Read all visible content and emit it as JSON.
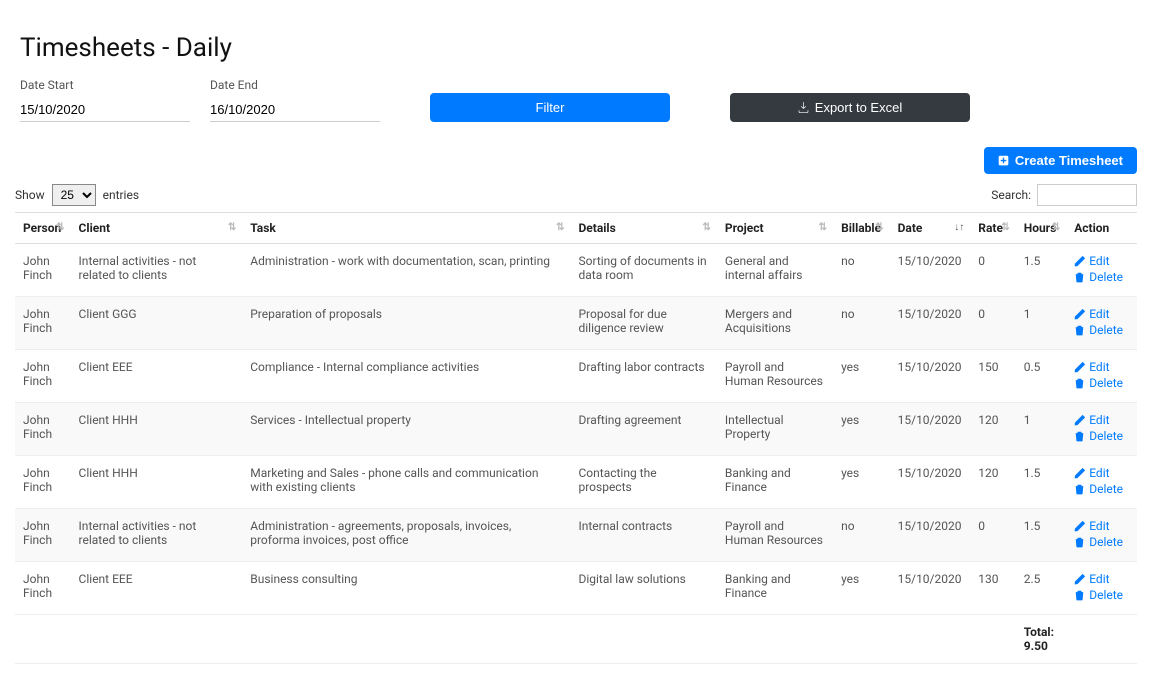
{
  "page_title": "Timesheets - Daily",
  "filters": {
    "date_start_label": "Date Start",
    "date_start_value": "15/10/2020",
    "date_end_label": "Date End",
    "date_end_value": "16/10/2020",
    "filter_button": "Filter",
    "export_button": "Export to Excel"
  },
  "create_button": "Create Timesheet",
  "entries": {
    "show_label": "Show",
    "entries_label": "entries",
    "selected": "25"
  },
  "search_label": "Search:",
  "columns": {
    "person": "Person",
    "client": "Client",
    "task": "Task",
    "details": "Details",
    "project": "Project",
    "billable": "Billable",
    "date": "Date",
    "rate": "Rate",
    "hours": "Hours",
    "action": "Action"
  },
  "rows": [
    {
      "person": "John Finch",
      "client": "Internal activities - not related to clients",
      "task": "Administration - work with documentation, scan, printing",
      "details": "Sorting of documents in data room",
      "project": "General and internal affairs",
      "billable": "no",
      "date": "15/10/2020",
      "rate": "0",
      "hours": "1.5"
    },
    {
      "person": "John Finch",
      "client": "Client GGG",
      "task": "Preparation of proposals",
      "details": "Proposal for due diligence review",
      "project": "Mergers and Acquisitions",
      "billable": "no",
      "date": "15/10/2020",
      "rate": "0",
      "hours": "1"
    },
    {
      "person": "John Finch",
      "client": "Client EEE",
      "task": "Compliance - Internal compliance activities",
      "details": "Drafting labor contracts",
      "project": "Payroll and Human Resources",
      "billable": "yes",
      "date": "15/10/2020",
      "rate": "150",
      "hours": "0.5"
    },
    {
      "person": "John Finch",
      "client": "Client HHH",
      "task": "Services - Intellectual property",
      "details": "Drafting agreement",
      "project": "Intellectual Property",
      "billable": "yes",
      "date": "15/10/2020",
      "rate": "120",
      "hours": "1"
    },
    {
      "person": "John Finch",
      "client": "Client HHH",
      "task": "Marketing and Sales - phone calls and communication with existing clients",
      "details": "Contacting the prospects",
      "project": "Banking and Finance",
      "billable": "yes",
      "date": "15/10/2020",
      "rate": "120",
      "hours": "1.5"
    },
    {
      "person": "John Finch",
      "client": "Internal activities - not related to clients",
      "task": "Administration - agreements, proposals, invoices, proforma invoices, post office",
      "details": "Internal contracts",
      "project": "Payroll and Human Resources",
      "billable": "no",
      "date": "15/10/2020",
      "rate": "0",
      "hours": "1.5"
    },
    {
      "person": "John Finch",
      "client": "Client EEE",
      "task": "Business consulting",
      "details": "Digital law solutions",
      "project": "Banking and Finance",
      "billable": "yes",
      "date": "15/10/2020",
      "rate": "130",
      "hours": "2.5"
    }
  ],
  "footer": {
    "total_label": "Total:",
    "total_value": "9.50"
  },
  "actions": {
    "edit": "Edit",
    "delete": "Delete"
  }
}
